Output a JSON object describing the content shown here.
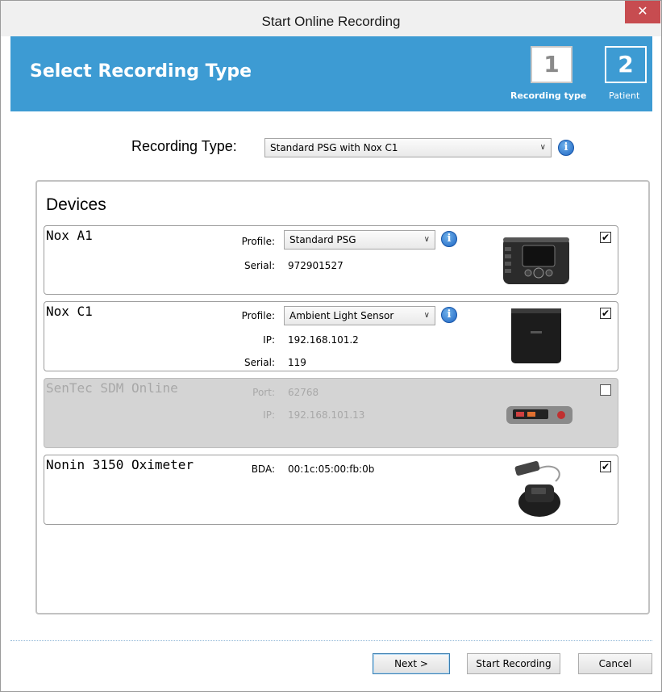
{
  "window": {
    "title": "Start Online Recording",
    "close_glyph": "✕"
  },
  "header": {
    "title": "Select Recording Type",
    "background_color": "#3d9bd3",
    "steps": [
      {
        "number": "1",
        "label": "Recording type",
        "active": true
      },
      {
        "number": "2",
        "label": "Patient",
        "active": false
      }
    ]
  },
  "recording_type": {
    "label": "Recording Type:",
    "selected": "Standard PSG with Nox C1",
    "info_glyph": "i"
  },
  "devices": {
    "title": "Devices",
    "items": [
      {
        "name": "Nox A1",
        "enabled": true,
        "checked": true,
        "fields": [
          {
            "label": "Profile:",
            "value": "Standard PSG"
          },
          {
            "label": "Serial:",
            "value": "972901527"
          }
        ],
        "image_icon": "nox-a1-device-icon"
      },
      {
        "name": "Nox C1",
        "enabled": true,
        "checked": true,
        "fields": [
          {
            "label": "Profile:",
            "value": "Ambient Light Sensor"
          },
          {
            "label": "IP:",
            "value": "192.168.101.2"
          },
          {
            "label": "Serial:",
            "value": "119"
          }
        ],
        "image_icon": "nox-c1-device-icon"
      },
      {
        "name": "SenTec SDM Online",
        "enabled": false,
        "checked": false,
        "fields": [
          {
            "label": "Port:",
            "value": "62768"
          },
          {
            "label": "IP:",
            "value": "192.168.101.13"
          }
        ],
        "image_icon": "sentec-device-icon"
      },
      {
        "name": "Nonin 3150 Oximeter",
        "enabled": true,
        "checked": true,
        "fields": [
          {
            "label": "BDA:",
            "value": "00:1c:05:00:fb:0b"
          }
        ],
        "image_icon": "nonin-oximeter-icon"
      }
    ]
  },
  "check_glyph": "✔",
  "dropdown_glyph": "∨",
  "footer": {
    "next_label": "Next >",
    "start_label": "Start Recording",
    "cancel_label": "Cancel"
  }
}
